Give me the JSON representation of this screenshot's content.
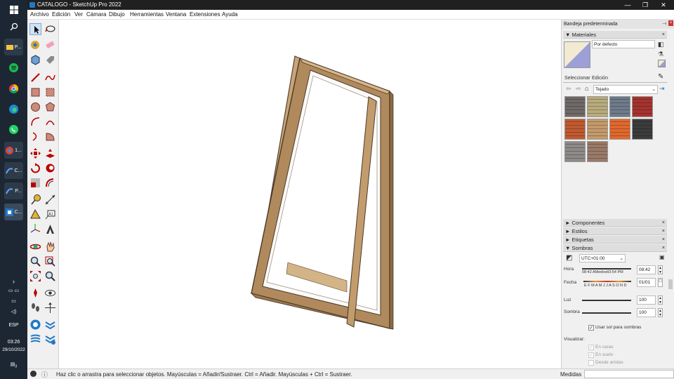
{
  "window": {
    "title": "CATALOGO - SketchUp Pro 2022",
    "minimize": "—",
    "maximize": "❐",
    "close": "✕"
  },
  "taskbar": {
    "apps": [
      {
        "name": "windows-icon",
        "label": ""
      },
      {
        "name": "search-icon",
        "label": ""
      },
      {
        "name": "explorer-icon",
        "label": "P..."
      },
      {
        "name": "spotify-icon",
        "label": ""
      },
      {
        "name": "chrome-icon",
        "label": ""
      },
      {
        "name": "edge-icon",
        "label": ""
      },
      {
        "name": "whatsapp-icon",
        "label": ""
      },
      {
        "name": "chrome-2-icon",
        "label": "1..."
      },
      {
        "name": "app-c-icon",
        "label": "C..."
      },
      {
        "name": "app-p-icon",
        "label": "P..."
      },
      {
        "name": "sketchup-icon",
        "label": "C..."
      }
    ],
    "lang": "ESP",
    "time": "03:26",
    "date": "29/10/2022",
    "notif_count": "3"
  },
  "menu": [
    "Archivo",
    "Edición",
    "Ver",
    "Cámara",
    "Dibujo",
    "Herramientas",
    "Ventana",
    "Extensiones",
    "Ayuda"
  ],
  "tray": {
    "title": "Bandeja predeterminada",
    "materials": {
      "header": "Materiales",
      "current": "Por defecto",
      "tab_select": "Seleccionar",
      "tab_edit": "Edición",
      "category": "Tejado",
      "swatches": [
        "#6f6a68",
        "#b8ab7c",
        "#6f7b8a",
        "#a53430",
        "#c05a30",
        "#c49a6c",
        "#e0692e",
        "#3c3c3c",
        "#8d8a88",
        "#9a7a68"
      ]
    },
    "collapsed": [
      "Componentes",
      "Estilos",
      "Etiquetas"
    ],
    "shadows": {
      "header": "Sombras",
      "utc": "UTC+01:00",
      "hora_label": "Hora",
      "hora_scale": "08:42 AMediodí3:54 PM",
      "hora_value": "08:42",
      "fecha_label": "Fecha",
      "fecha_scale": "E F M A M J J A S O N D",
      "fecha_value": "01/01",
      "luz_label": "Luz",
      "luz_value": "100",
      "sombra_label": "Sombra",
      "sombra_value": "100",
      "use_sun": "Usar sol para sombras",
      "visualizar": "Visualizar:",
      "on_faces": "En caras",
      "on_ground": "En suelo",
      "from_edges": "Desde aristas"
    }
  },
  "status": {
    "text": "Haz clic o arrastra para seleccionar objetos. Mayúsculas = Añadir/Sustraer. Ctrl = Añadir. Mayúsculas + Ctrl = Sustraer.",
    "measure_label": "Medidas"
  }
}
